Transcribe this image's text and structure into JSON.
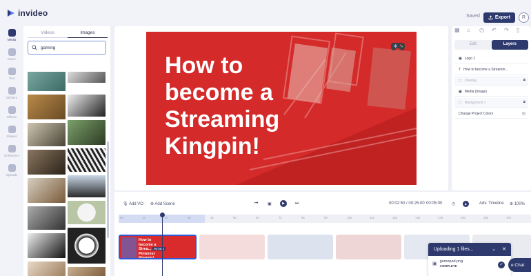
{
  "header": {
    "logo_text": "invideo",
    "saved_status": "Saved",
    "export_label": "Export",
    "avatar_initial": "R"
  },
  "rail": {
    "items": [
      {
        "label": "Media",
        "icon": "media-icon"
      },
      {
        "label": "Music",
        "icon": "music-icon"
      },
      {
        "label": "Text",
        "icon": "text-icon"
      },
      {
        "label": "Stickers",
        "icon": "stickers-icon"
      },
      {
        "label": "Effects",
        "icon": "effects-icon"
      },
      {
        "label": "Shapes",
        "icon": "shapes-icon"
      },
      {
        "label": "Enhancers",
        "icon": "enhancers-icon"
      },
      {
        "label": "Uploads",
        "icon": "uploads-icon"
      }
    ]
  },
  "media_panel": {
    "tabs": [
      "Videos",
      "Images"
    ],
    "search_value": "gaming"
  },
  "canvas": {
    "title": "How to become a Streaming Kingpin!"
  },
  "right_panel": {
    "tabs": [
      "Edit",
      "Layers"
    ],
    "layers": [
      "Logo 1",
      "How to become a Streamin...",
      "Overlay",
      "Media (Image)",
      "Background 1",
      "Change Project Colors"
    ]
  },
  "timeline": {
    "add_vo": "Add VO",
    "add_scene": "Add Scene",
    "time_readout": "00:02:50 / 00:25:00",
    "scene_duration": "00:05:00",
    "adv_timeline": "Adv. Timeline",
    "zoom": "100%",
    "ticks": [
      "0s",
      "1s",
      "2s",
      "3s",
      "4s",
      "5s",
      "6s",
      "7s",
      "8s",
      "9s",
      "10s",
      "11s",
      "12s",
      "13s",
      "14s",
      "15s",
      "16s",
      "17s",
      "18s"
    ],
    "clip1_text": "How to become a Strea... Pinterest Kingpin!",
    "clip1_time": "00:05:0"
  },
  "upload": {
    "title": "Uploading 1 files...",
    "file_name": "gamepad.png",
    "status": "COMPLETE"
  },
  "chat": {
    "label": "e Chat"
  },
  "colors": {
    "brand": "#2e3a6e",
    "canvas_red": "#d92b2b"
  }
}
